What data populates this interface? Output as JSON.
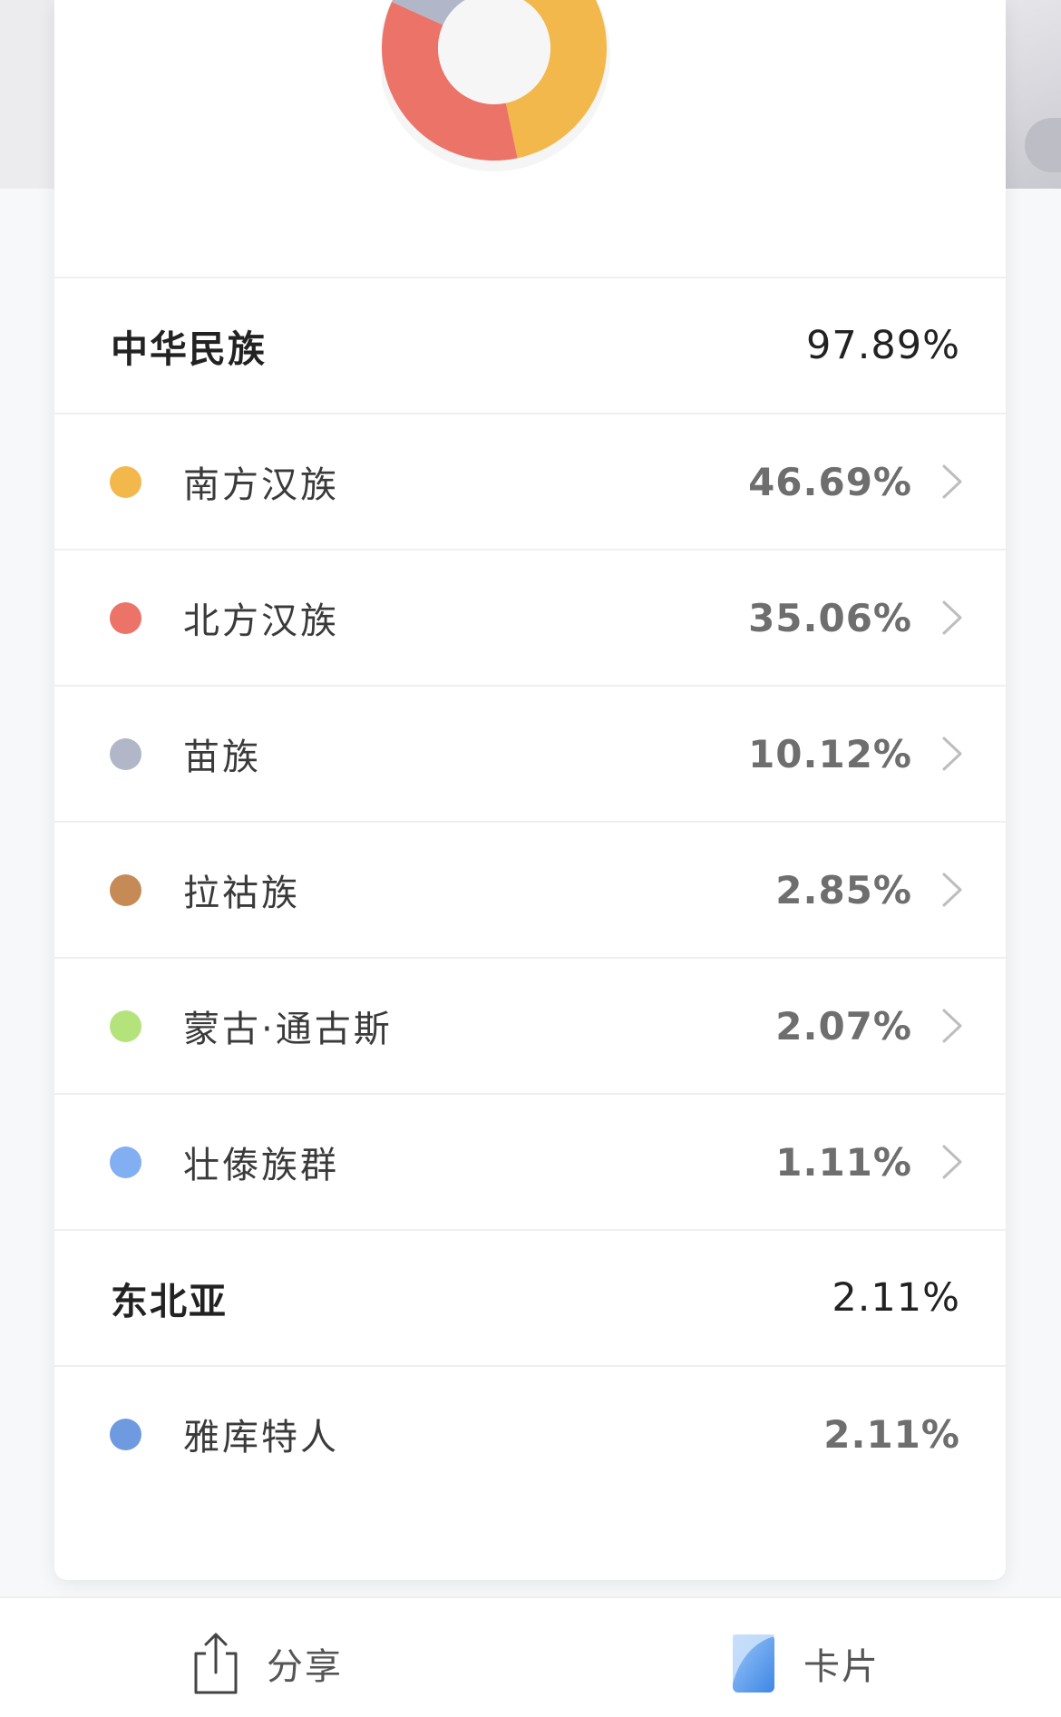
{
  "chart_data": {
    "type": "pie",
    "categories": [
      "南方汉族",
      "北方汉族",
      "苗族",
      "拉祜族",
      "蒙古·通古斯",
      "壮傣族群",
      "雅库特人"
    ],
    "values": [
      46.69,
      35.06,
      10.12,
      2.85,
      2.07,
      1.11,
      2.11
    ],
    "colors": [
      "#f2b84b",
      "#ec7368",
      "#b1b7c8",
      "#c68a56",
      "#b5e37b",
      "#82aef2",
      "#6e9ae0"
    ]
  },
  "groups": [
    {
      "name": "中华民族",
      "percent": "97.89%",
      "items": [
        {
          "name": "南方汉族",
          "percent": "46.69%",
          "color": "#f2b84b",
          "icon": "chevron-right-icon"
        },
        {
          "name": "北方汉族",
          "percent": "35.06%",
          "color": "#ec7368",
          "icon": "chevron-right-icon"
        },
        {
          "name": "苗族",
          "percent": "10.12%",
          "color": "#b1b7c8",
          "icon": "chevron-right-icon"
        },
        {
          "name": "拉祜族",
          "percent": "2.85%",
          "color": "#c68a56",
          "icon": "chevron-right-icon"
        },
        {
          "name": "蒙古·通古斯",
          "percent": "2.07%",
          "color": "#b5e37b",
          "icon": "chevron-right-icon"
        },
        {
          "name": "壮傣族群",
          "percent": "1.11%",
          "color": "#82aef2",
          "icon": "chevron-right-icon"
        }
      ]
    },
    {
      "name": "东北亚",
      "percent": "2.11%",
      "items": [
        {
          "name": "雅库特人",
          "percent": "2.11%",
          "color": "#6e9ae0"
        }
      ]
    }
  ],
  "bottom_bar": {
    "share_label": "分享",
    "share_icon": "share-icon",
    "card_label": "卡片",
    "card_icon": "card-icon"
  }
}
